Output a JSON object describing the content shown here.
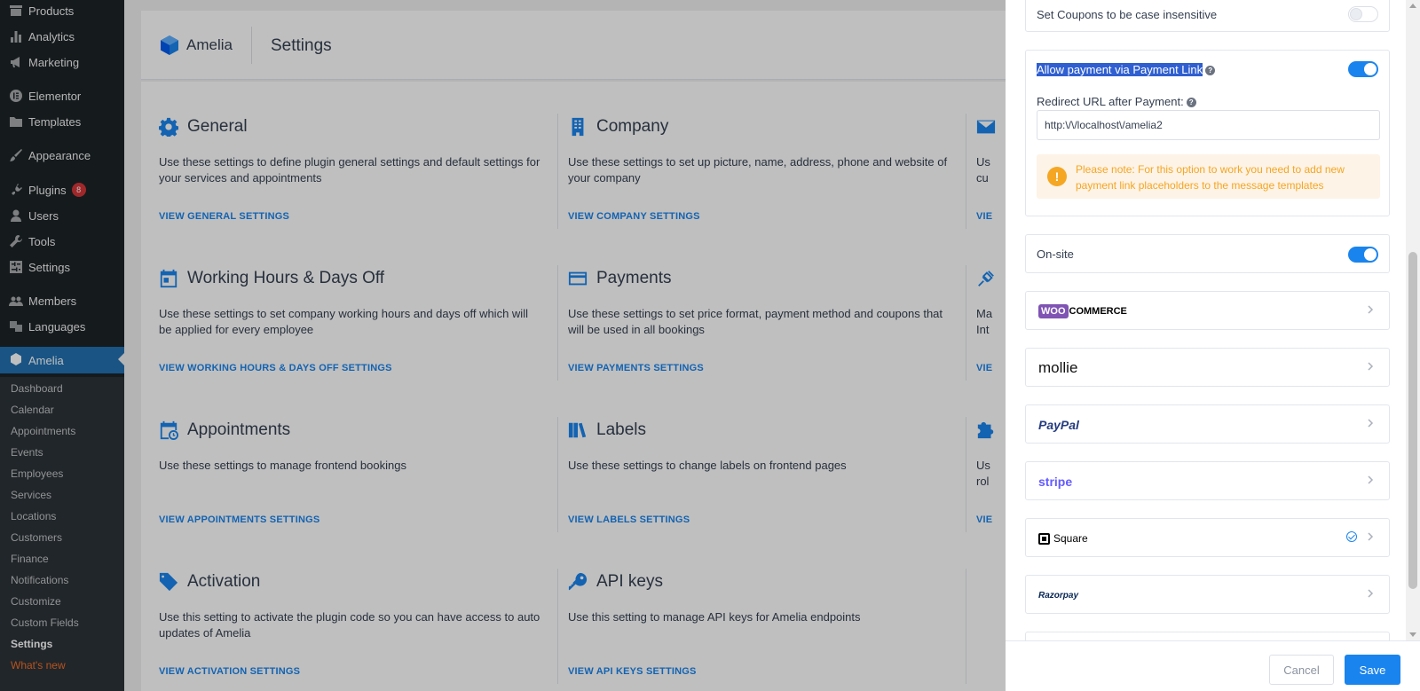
{
  "admin_menu": {
    "items": [
      {
        "label": "Products",
        "icon": "archive-icon"
      },
      {
        "label": "Analytics",
        "icon": "bar-chart-icon"
      },
      {
        "label": "Marketing",
        "icon": "megaphone-icon"
      },
      {
        "label": "Elementor",
        "icon": "elementor-icon"
      },
      {
        "label": "Templates",
        "icon": "folder-icon"
      },
      {
        "label": "Appearance",
        "icon": "paintbrush-icon"
      },
      {
        "label": "Plugins",
        "icon": "plug-icon",
        "badge": "8"
      },
      {
        "label": "Users",
        "icon": "user-icon"
      },
      {
        "label": "Tools",
        "icon": "wrench-icon"
      },
      {
        "label": "Settings",
        "icon": "sliders-icon"
      },
      {
        "label": "Members",
        "icon": "group-icon"
      },
      {
        "label": "Languages",
        "icon": "translate-icon"
      },
      {
        "label": "Amelia",
        "icon": "amelia-icon"
      }
    ],
    "submenu": [
      "Dashboard",
      "Calendar",
      "Appointments",
      "Events",
      "Employees",
      "Services",
      "Locations",
      "Customers",
      "Finance",
      "Notifications",
      "Customize",
      "Custom Fields",
      "Settings",
      "What's new"
    ]
  },
  "header": {
    "brand": "Amelia",
    "title": "Settings"
  },
  "cards": [
    {
      "title": "General",
      "icon": "gear-icon",
      "description": "Use these settings to define plugin general settings and default settings for your services and appointments",
      "link": "VIEW GENERAL SETTINGS"
    },
    {
      "title": "Company",
      "icon": "building-icon",
      "description": "Use these settings to set up picture, name, address, phone and website of your company",
      "link": "VIEW COMPANY SETTINGS"
    },
    {
      "title": "Working Hours & Days Off",
      "icon": "calendar-icon",
      "description": "Use these settings to set company working hours and days off which will be applied for every employee",
      "link": "VIEW WORKING HOURS & DAYS OFF SETTINGS"
    },
    {
      "title": "Payments",
      "icon": "credit-card-icon",
      "description": "Use these settings to set price format, payment method and coupons that will be used in all bookings",
      "link": "VIEW PAYMENTS SETTINGS"
    },
    {
      "title": "Appointments",
      "icon": "calendar-clock-icon",
      "description": "Use these settings to manage frontend bookings",
      "link": "VIEW APPOINTMENTS SETTINGS"
    },
    {
      "title": "Labels",
      "icon": "books-icon",
      "description": "Use these settings to change labels on frontend pages",
      "link": "VIEW LABELS SETTINGS"
    },
    {
      "title": "Activation",
      "icon": "tag-heart-icon",
      "description": "Use this setting to activate the plugin code so you can have access to auto updates of Amelia",
      "link": "VIEW ACTIVATION SETTINGS"
    },
    {
      "title": "API keys",
      "icon": "key-icon",
      "description": "Use this setting to manage API keys for Amelia endpoints",
      "link": "VIEW API KEYS SETTINGS"
    }
  ],
  "third_column": {
    "fragments": [
      {
        "icon": "envelope-icon",
        "text": [
          "Us",
          "cu"
        ],
        "link": "VIE"
      },
      {
        "icon": "integration-icon",
        "text": [
          "Ma",
          "Int"
        ],
        "link": "VIE"
      },
      {
        "icon": "puzzle-icon",
        "text": [
          "Us",
          "rol"
        ],
        "link": "VIE"
      }
    ]
  },
  "drawer": {
    "coupons_case": {
      "label": "Set Coupons to be case insensitive",
      "enabled": false
    },
    "payment_link": {
      "label": "Allow payment via Payment Link",
      "enabled": true,
      "redirect_label": "Redirect URL after Payment:",
      "redirect_value": "http:\\/\\/localhost\\/amelia2",
      "note": "Please note: For this option to work you need to add new payment link placeholders to the message templates"
    },
    "onsite": {
      "label": "On-site",
      "enabled": true
    },
    "gateways": [
      {
        "name": "WooCommerce",
        "logo_a": "WOO",
        "logo_b": "COMMERCE",
        "color": "#7f54b3"
      },
      {
        "name": "mollie",
        "color": "#111111"
      },
      {
        "name": "PayPal",
        "color": "#253b80"
      },
      {
        "name": "stripe",
        "color": "#635bff"
      },
      {
        "name": "Square",
        "color": "#000000",
        "connected": true
      },
      {
        "name": "Razorpay",
        "color": "#072654"
      }
    ],
    "cancel_label": "Cancel",
    "save_label": "Save"
  },
  "colors": {
    "accent": "#1a84ee",
    "warning": "#f5a623",
    "sidebar": "#1d2327",
    "current": "#2271b1"
  }
}
